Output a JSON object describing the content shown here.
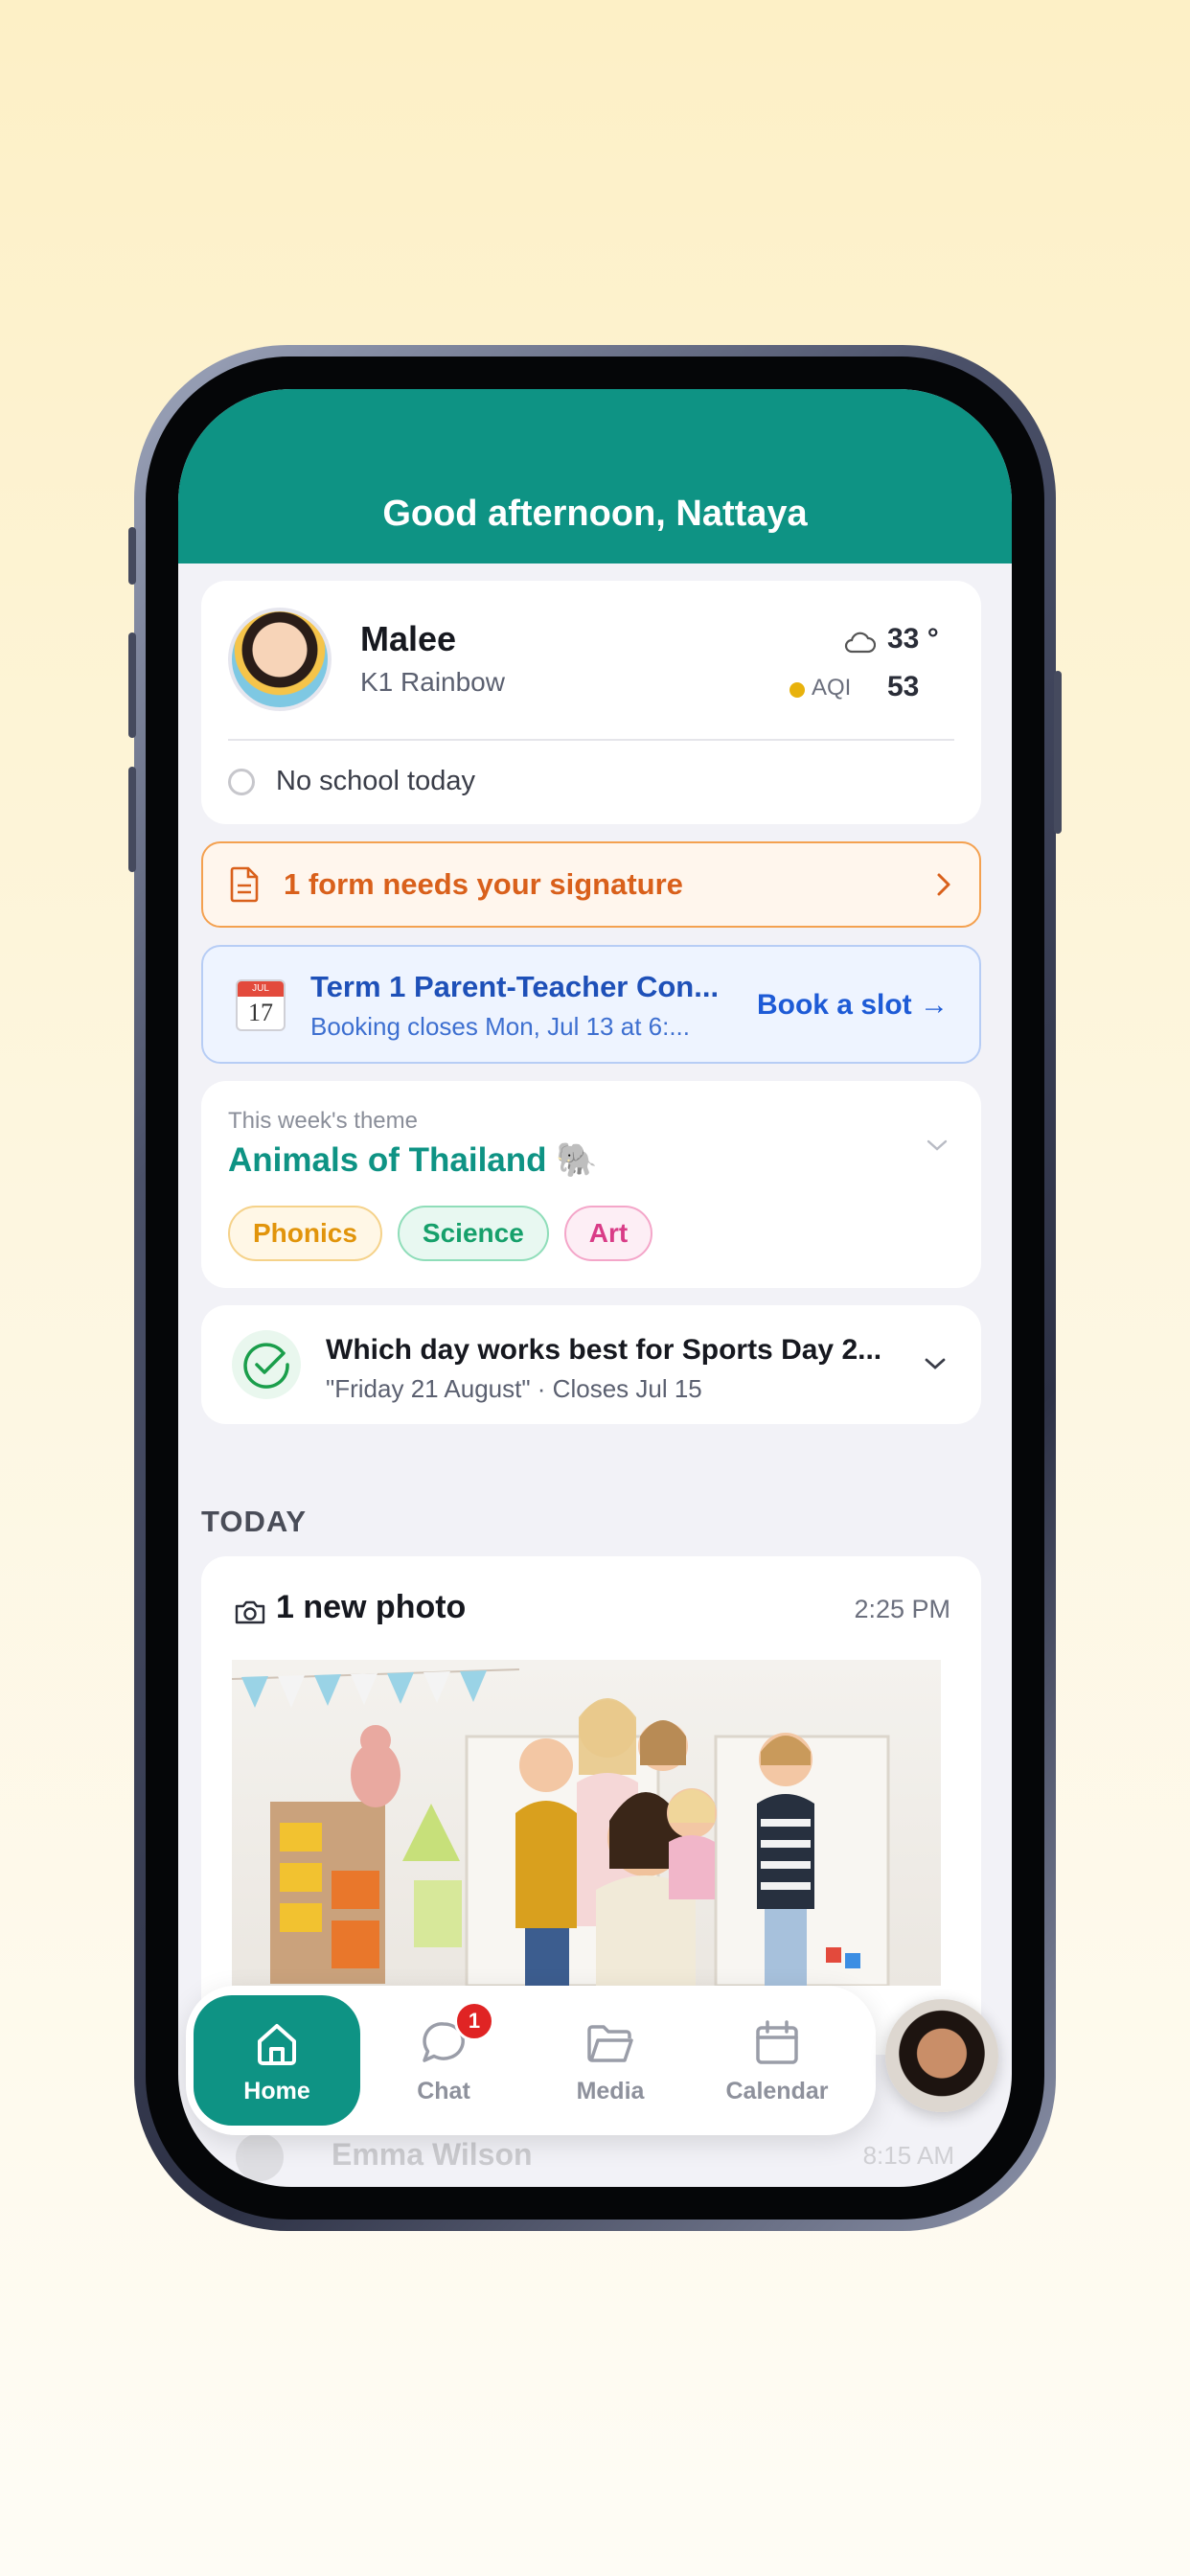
{
  "header": {
    "greeting": "Good afternoon, Nattaya"
  },
  "child": {
    "name": "Malee",
    "class": "K1 Rainbow",
    "weather": {
      "temperature": "33 °",
      "aqi_label": "AQI",
      "aqi_value": "53",
      "icon": "cloud-icon"
    },
    "school_status": "No school today"
  },
  "form_banner": {
    "text": "1 form needs your signature",
    "icon": "document-icon"
  },
  "booking": {
    "title": "Term 1 Parent-Teacher Con...",
    "subtitle": "Booking closes Mon, Jul 13 at 6:...",
    "action": "Book a slot →",
    "calendar_month": "JUL",
    "calendar_day": "17"
  },
  "theme": {
    "label": "This week's theme",
    "title": "Animals of Thailand 🐘",
    "tags": [
      "Phonics",
      "Science",
      "Art"
    ]
  },
  "poll": {
    "title": "Which day works best for Sports Day 2...",
    "subtitle": "\"Friday 21 August\" · Closes Jul 15"
  },
  "today": {
    "section_title": "TODAY",
    "photo_post": {
      "title": "1 new photo",
      "time": "2:25 PM"
    },
    "next_post": {
      "name": "Emma Wilson",
      "time": "8:15 AM"
    }
  },
  "tabbar": {
    "tabs": [
      {
        "label": "Home",
        "icon": "home-icon",
        "active": true
      },
      {
        "label": "Chat",
        "icon": "chat-icon",
        "badge": "1"
      },
      {
        "label": "Media",
        "icon": "folder-icon"
      },
      {
        "label": "Calendar",
        "icon": "calendar-icon"
      }
    ]
  },
  "colors": {
    "primary": "#0e9384",
    "warning": "#d9601b",
    "link": "#1e5bd6",
    "badge": "#e02424"
  }
}
